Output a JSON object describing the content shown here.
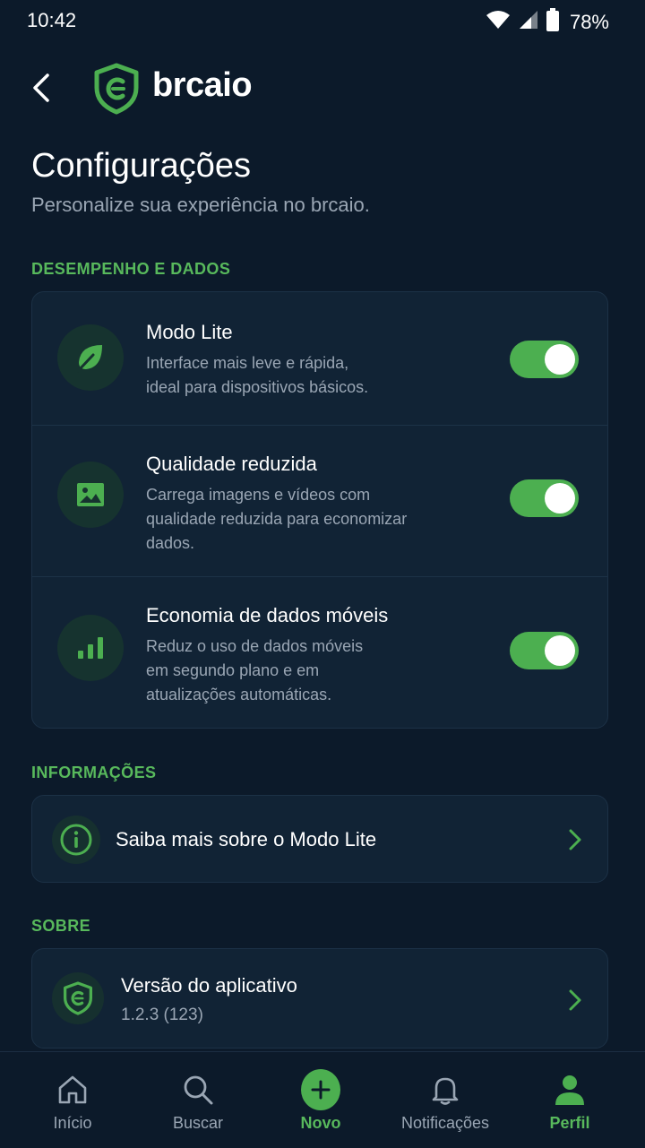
{
  "status_bar": {
    "time": "10:42",
    "battery": "78%"
  },
  "header": {
    "brand": "brcaio"
  },
  "page": {
    "title": "Configurações",
    "subtitle": "Personalize sua experiência no brcaio."
  },
  "sections": {
    "performance": {
      "label": "DESEMPENHO E DADOS",
      "items": [
        {
          "title": "Modo Lite",
          "desc_lines": [
            "Interface mais leve e rápida,",
            "ideal para dispositivos básicos."
          ],
          "enabled": true,
          "icon": "leaf-icon"
        },
        {
          "title": "Qualidade reduzida",
          "desc_lines": [
            "Carrega imagens e vídeos com",
            "qualidade reduzida para economizar",
            "dados."
          ],
          "enabled": true,
          "icon": "image-icon"
        },
        {
          "title": "Economia de dados móveis",
          "desc_lines": [
            "Reduz o uso de dados móveis",
            "em segundo plano e em",
            "atualizações automáticas."
          ],
          "enabled": true,
          "icon": "signal-bars-icon"
        }
      ]
    },
    "info": {
      "label": "INFORMAÇÕES",
      "link": "Saiba mais sobre o Modo Lite"
    },
    "about": {
      "label": "SOBRE",
      "version_title": "Versão do aplicativo",
      "version_value": "1.2.3 (123)"
    }
  },
  "bottom_nav": {
    "items": [
      {
        "label": "Início",
        "icon": "home-icon",
        "active": false
      },
      {
        "label": "Buscar",
        "icon": "search-icon",
        "active": false
      },
      {
        "label": "Novo",
        "icon": "plus-icon",
        "active": false
      },
      {
        "label": "Notificações",
        "icon": "bell-icon",
        "active": false
      },
      {
        "label": "Perfil",
        "icon": "user-icon",
        "active": true
      }
    ]
  },
  "colors": {
    "background": "#0c1a2a",
    "card": "#112335",
    "accent": "#4caf50",
    "accent_text": "#58b95c",
    "muted_text": "#9aa6b4"
  }
}
